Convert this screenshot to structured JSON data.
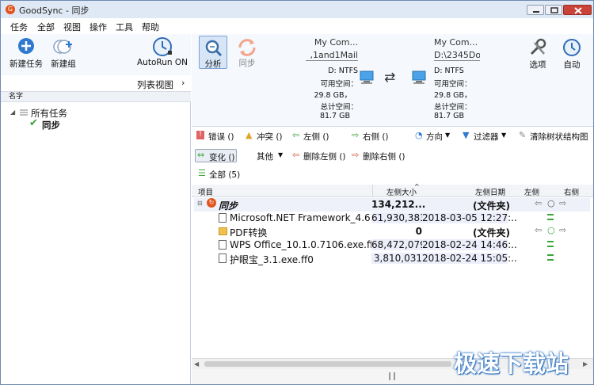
{
  "window": {
    "title": "GoodSync - 同步"
  },
  "menu": [
    "任务",
    "全部",
    "视图",
    "操作",
    "工具",
    "帮助"
  ],
  "left_toolbar": {
    "new_task": "新建任务",
    "new_group": "新建组",
    "autorun": "AutoRun ON"
  },
  "list_view": "列表视图",
  "tree": {
    "header": "名字",
    "all_tasks": "所有任务",
    "sync_task": "同步"
  },
  "toolbar": {
    "analyze": "分析",
    "sync": "同步",
    "options": "选项",
    "auto": "自动",
    "left": {
      "computer": "My Com...",
      "path": ",1and1Mail",
      "fs": "D: NTFS",
      "free_label": "可用空间：",
      "free": "29.8 GB，",
      "total_label": "总计空间：",
      "total": "81.7 GB"
    },
    "right": {
      "computer": "My Com...",
      "path": "D:\\2345Do",
      "fs": "D: NTFS",
      "free_label": "可用空间：",
      "free": "29.8 GB，",
      "total_label": "总计空间：",
      "total": "81.7 GB"
    }
  },
  "filters": {
    "errors": "错误 ()",
    "conflicts": "冲突 ()",
    "left_side": "左侧 ()",
    "right_side": "右侧 ()",
    "direction": "方向",
    "filter": "过滤器",
    "clear_tree": "清除树状结构图",
    "changes": "变化 ()",
    "other": "其他",
    "delete_left": "删除左侧 ()",
    "delete_right": "删除右侧 ()",
    "all": "全部 (5)"
  },
  "columns": {
    "item": "项目",
    "left_size": "左侧大小",
    "left_date": "左侧日期",
    "left": "左侧",
    "right": "右侧"
  },
  "rows": [
    {
      "name": "同步",
      "size": "134,212...",
      "date": "(文件夹)",
      "kind": "root"
    },
    {
      "name": "Microsoft.NET Framework_4.6...",
      "size": "61,930,383",
      "date": "2018-03-05  12:27:..",
      "kind": "file"
    },
    {
      "name": "PDF转换",
      "size": "0",
      "date": "(文件夹)",
      "kind": "folder"
    },
    {
      "name": "WPS Office_10.1.0.7106.exe.ff0",
      "size": "68,472,079",
      "date": "2018-02-24  14:46:..",
      "kind": "file"
    },
    {
      "name": "护眼宝_3.1.exe.ff0",
      "size": "3,810,031",
      "date": "2018-02-24  15:05:..",
      "kind": "file"
    }
  ],
  "watermark": "极速下载站",
  "colors": {
    "accent": "#2f7ad0",
    "sync_orange": "#e2541b",
    "green": "#3aa538"
  }
}
